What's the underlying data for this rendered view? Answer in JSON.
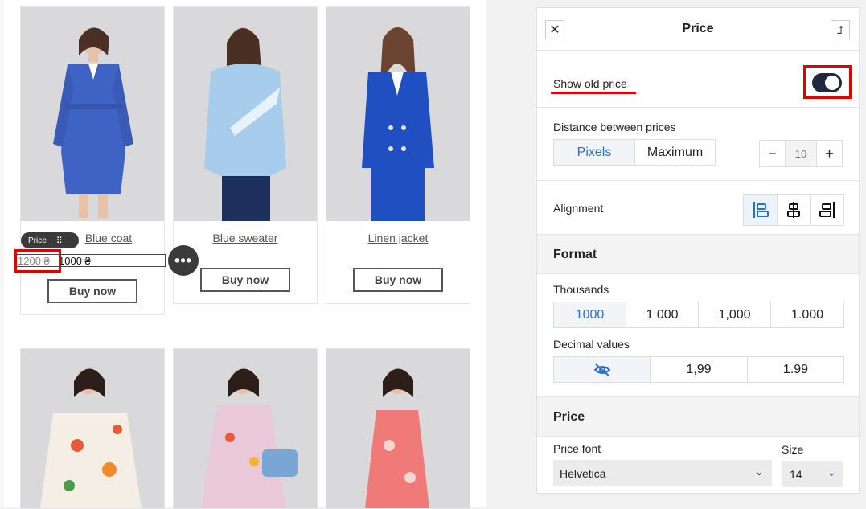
{
  "products": [
    {
      "title": "Blue coat",
      "old_price": "1200 ₴",
      "price": "1000 ₴",
      "buy": "Buy now",
      "coat_color": "#3f63c4"
    },
    {
      "title": "Blue sweater",
      "buy": "Buy now",
      "coat_color": "#a8cdec"
    },
    {
      "title": "Linen jacket",
      "buy": "Buy now",
      "coat_color": "#1f4fc0"
    },
    {
      "coat_color": "#f4eee4"
    },
    {
      "coat_color": "#e9c8d8"
    },
    {
      "coat_color": "#f07a78"
    }
  ],
  "element_tag": {
    "label": "Price"
  },
  "panel": {
    "title": "Price",
    "show_old_price": {
      "label": "Show old price",
      "enabled": true
    },
    "distance": {
      "label": "Distance between prices",
      "options": [
        "Pixels",
        "Maximum"
      ],
      "selected": "Pixels",
      "value": "10",
      "minus": "−",
      "plus": "+"
    },
    "alignment": {
      "label": "Alignment",
      "selected": "left"
    },
    "format_heading": "Format",
    "thousands": {
      "label": "Thousands",
      "options": [
        "1000",
        "1 000",
        "1,000",
        "1.000"
      ],
      "selected": "1000"
    },
    "decimal": {
      "label": "Decimal values",
      "options": [
        "1,99",
        "1.99"
      ]
    },
    "price_heading": "Price",
    "price_font": {
      "label": "Price font",
      "value": "Helvetica"
    },
    "size": {
      "label": "Size",
      "value": "14"
    }
  },
  "colors": {
    "accent": "#2a6fd6",
    "highlight": "#e00000",
    "toggle": "#1f2a3c"
  }
}
